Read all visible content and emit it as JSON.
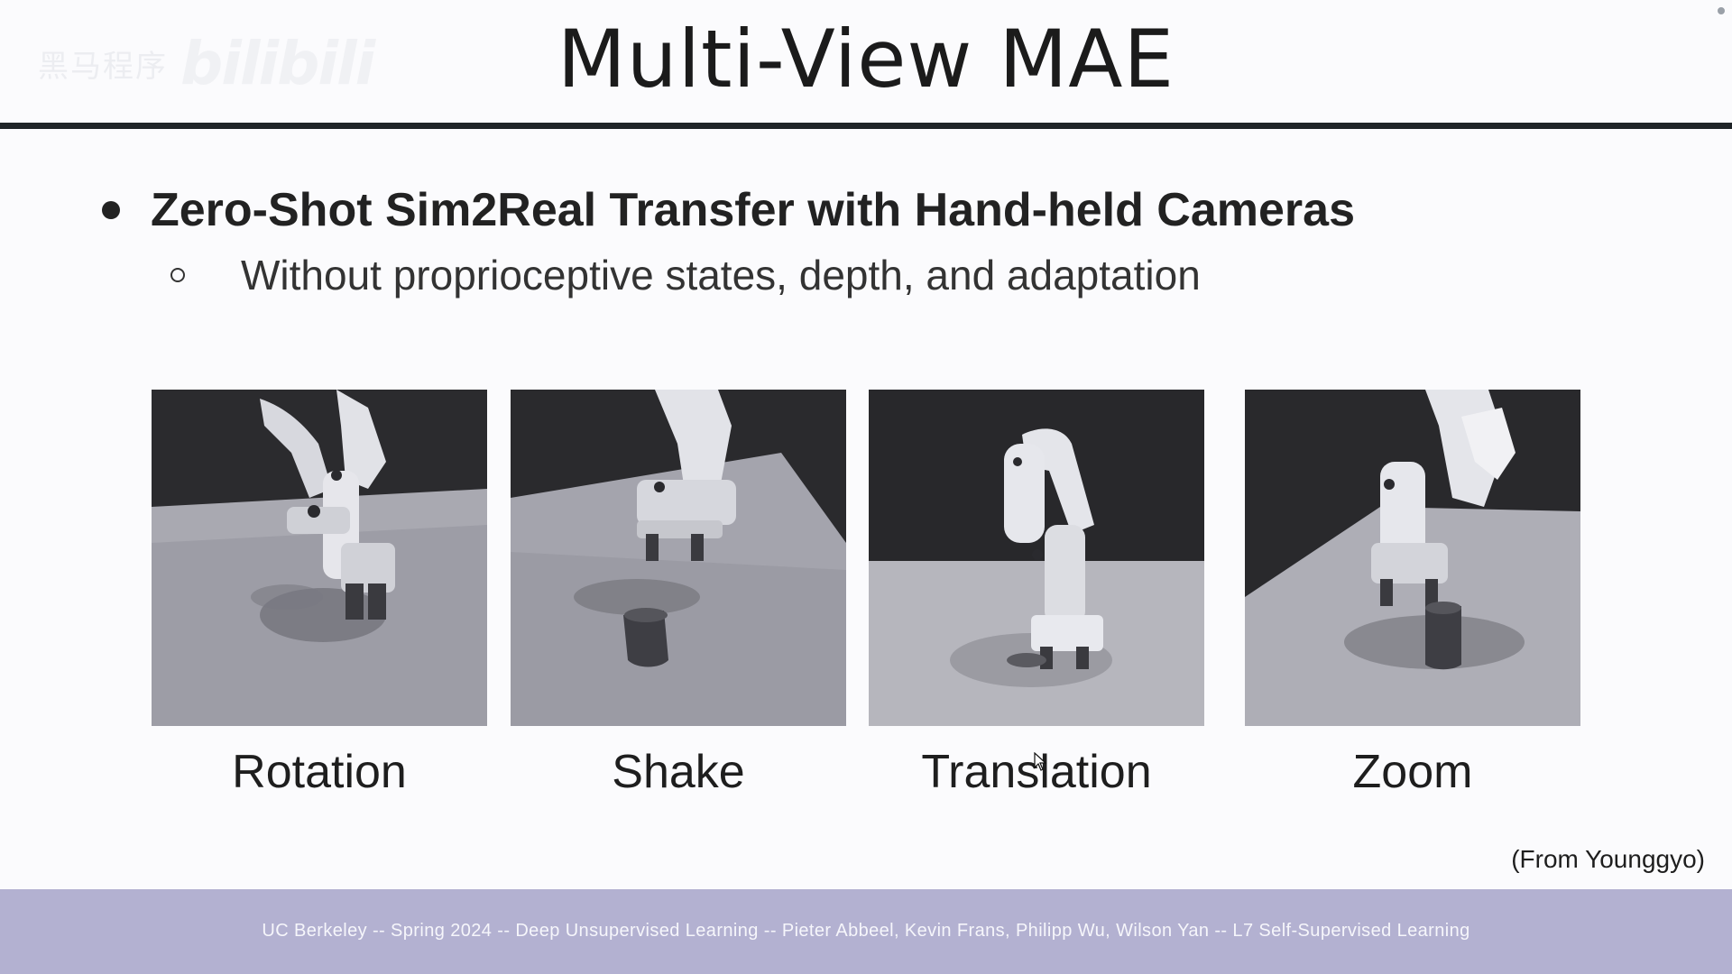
{
  "watermark": {
    "text": "黑马程序",
    "logo": "bilibili"
  },
  "slide": {
    "title": "Multi-View MAE",
    "bullet": "Zero-Shot Sim2Real Transfer with Hand-held Cameras",
    "sub_bullet": "Without proprioceptive states, depth, and adaptation",
    "panels": [
      {
        "caption": "Rotation",
        "image": "robot-arm-rotation-photo"
      },
      {
        "caption": "Shake",
        "image": "robot-arm-shake-photo"
      },
      {
        "caption": "Translation",
        "image": "robot-arm-translation-photo"
      },
      {
        "caption": "Zoom",
        "image": "robot-arm-zoom-photo"
      }
    ],
    "credit": "(From Younggyo)"
  },
  "footer": {
    "text": "UC Berkeley -- Spring 2024 -- Deep Unsupervised Learning -- Pieter Abbeel, Kevin Frans, Philipp Wu, Wilson Yan -- L7 Self-Supervised Learning"
  },
  "colors": {
    "footer_bg": "#b3b1d1",
    "title_rule": "#1f2427",
    "text": "#222222"
  }
}
